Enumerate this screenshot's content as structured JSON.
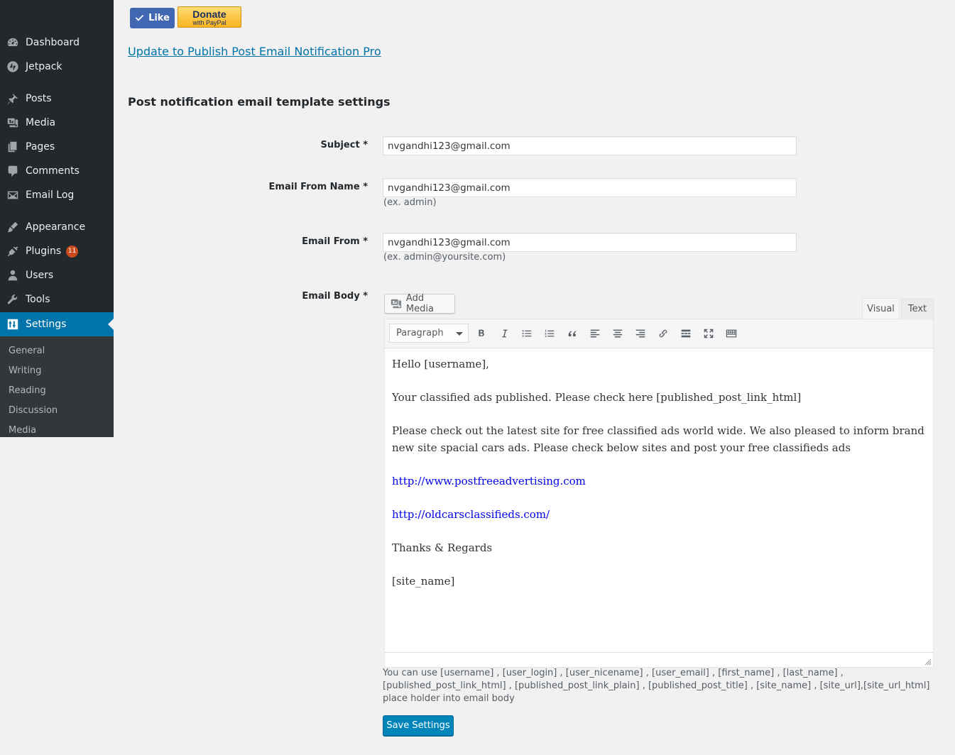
{
  "sidebar": {
    "items": [
      {
        "label": "Dashboard",
        "icon": "dashboard-icon"
      },
      {
        "label": "Jetpack",
        "icon": "jetpack-icon"
      },
      {
        "label": "Posts",
        "icon": "pushpin-icon"
      },
      {
        "label": "Media",
        "icon": "media-icon"
      },
      {
        "label": "Pages",
        "icon": "pages-icon"
      },
      {
        "label": "Comments",
        "icon": "comment-icon"
      },
      {
        "label": "Email Log",
        "icon": "envelope-icon"
      },
      {
        "label": "Appearance",
        "icon": "paintbrush-icon"
      },
      {
        "label": "Plugins",
        "icon": "plugin-icon",
        "badge": "11"
      },
      {
        "label": "Users",
        "icon": "user-icon"
      },
      {
        "label": "Tools",
        "icon": "wrench-icon"
      },
      {
        "label": "Settings",
        "icon": "settings-icon",
        "active": true
      }
    ],
    "submenu": [
      "General",
      "Writing",
      "Reading",
      "Discussion",
      "Media"
    ]
  },
  "top": {
    "like_label": "Like",
    "donate_main": "Donate",
    "donate_sub": "with PayPal",
    "pro_link": "Update to Publish Post Email Notification Pro"
  },
  "section_title": "Post notification email template settings",
  "form": {
    "subject": {
      "label": "Subject *",
      "value": "nvgandhi123@gmail.com"
    },
    "from_name": {
      "label": "Email From Name *",
      "value": "nvgandhi123@gmail.com",
      "hint": "(ex. admin)"
    },
    "from_email": {
      "label": "Email From *",
      "value": "nvgandhi123@gmail.com",
      "hint": "(ex. admin@yoursite.com)"
    },
    "body_label": "Email Body *"
  },
  "editor": {
    "add_media_label": "Add Media",
    "tabs": {
      "visual": "Visual",
      "text": "Text"
    },
    "format_select": "Paragraph",
    "toolbar_icons": [
      "bold-icon",
      "italic-icon",
      "bullet-list-icon",
      "numbered-list-icon",
      "blockquote-icon",
      "align-left-icon",
      "align-center-icon",
      "align-right-icon",
      "link-icon",
      "read-more-icon",
      "fullscreen-icon",
      "toolbar-toggle-icon"
    ],
    "content": {
      "greeting": "Hello [username],",
      "line1": "Your classified ads published. Please check here [published_post_link_html]",
      "line2": "Please check out the latest site for free classified ads world wide. We also pleased to inform brand new site spacial cars ads. Please check below sites and post your free classifieds ads",
      "link1": "http://www.postfreeadvertising.com",
      "link2": "http://oldcarsclassifieds.com/",
      "closing": "Thanks & Regards",
      "signature": "[site_name]"
    }
  },
  "placeholders_help": "You can use [username] , [user_login] , [user_nicename] , [user_email] , [first_name] , [last_name] ,[published_post_link_html] , [published_post_link_plain] , [published_post_title] , [site_name] , [site_url],[site_url_html] place holder into email body",
  "save_label": "Save Settings",
  "colors": {
    "sidebar_bg": "#23282d",
    "submenu_bg": "#32373c",
    "accent": "#0073aa",
    "button_primary": "#0085ba",
    "facebook_blue": "#4267b2",
    "badge": "#ca4a1f"
  }
}
